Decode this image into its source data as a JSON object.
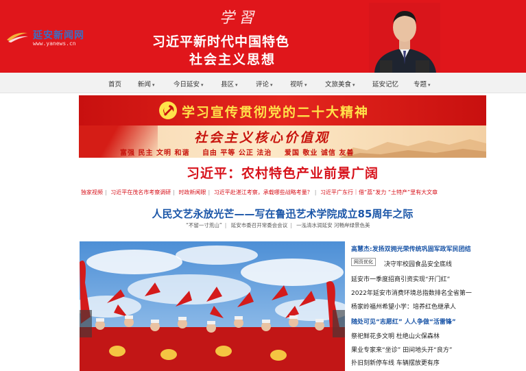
{
  "header": {
    "logo_name": "延安新闻网",
    "logo_url": "www.yanews.cn",
    "calligraphy": "学習",
    "banner_line1": "习近平新时代中国特色",
    "banner_line2": "社会主义思想"
  },
  "nav": {
    "items": [
      {
        "label": "首页",
        "has_caret": false
      },
      {
        "label": "新闻",
        "has_caret": true
      },
      {
        "label": "今日延安",
        "has_caret": true
      },
      {
        "label": "县区",
        "has_caret": true
      },
      {
        "label": "评论",
        "has_caret": true
      },
      {
        "label": "视听",
        "has_caret": true
      },
      {
        "label": "文旅美食",
        "has_caret": true
      },
      {
        "label": "延安记忆",
        "has_caret": false
      },
      {
        "label": "专题",
        "has_caret": true
      }
    ]
  },
  "promo": {
    "banner1_text": "学习宣传贯彻党的二十大精神",
    "banner2_heading": "社会主义核心价值观",
    "core_values": [
      "富强 民主 文明 和谐",
      "自由 平等 公正 法治",
      "爱国 敬业 诚信 友善"
    ]
  },
  "headline": {
    "main": "习近平：农村特色产业前景广阔",
    "hot_links": [
      "独家视频",
      "习近平在茂名市考察调研",
      "时政新闻眼",
      "习近平赴湛江考察，承载哪些战略考量？",
      "习近平广东行｜借“荔”发力 “土特产”里有大文章"
    ],
    "sub": "人民文艺永放光芒——写在鲁迅艺术学院成立85周年之际",
    "sub_links": [
      "“不留一寸荒山”",
      "延安市委召开常委会会议",
      "一泓清水润延安 河畅岸绿景色美"
    ]
  },
  "news": {
    "badge": "网页优化",
    "items": [
      {
        "text": "高慧杰:发扬双拥光荣传统巩固军政军民团结",
        "highlight": true
      },
      {
        "text": "决守牢校园食品安全底线",
        "highlight": false
      },
      {
        "text": "延安市一季度招商引资实现“开门红”",
        "highlight": false
      },
      {
        "text": "2022年延安市消费环境总指数排名全省第一",
        "highlight": false
      },
      {
        "text": "杨家岭福州希望小学：培养红色继承人",
        "highlight": false
      },
      {
        "text": "随处可见“志愿红” 人人争做“活雷锋”",
        "highlight": true
      },
      {
        "text": "祭祀鲜花多文明 杜绝山火保森林",
        "highlight": false
      },
      {
        "text": "果业专家来“坐诊” 田间地头开“良方”",
        "highlight": false
      },
      {
        "text": "扑旧刻新停车线 车辆摆放更有序",
        "highlight": false
      }
    ]
  },
  "colors": {
    "brand_red": "#e0161b",
    "headline_red": "#d7121b",
    "link_blue": "#1b56a8",
    "banner_yellow": "#ffe24a"
  }
}
